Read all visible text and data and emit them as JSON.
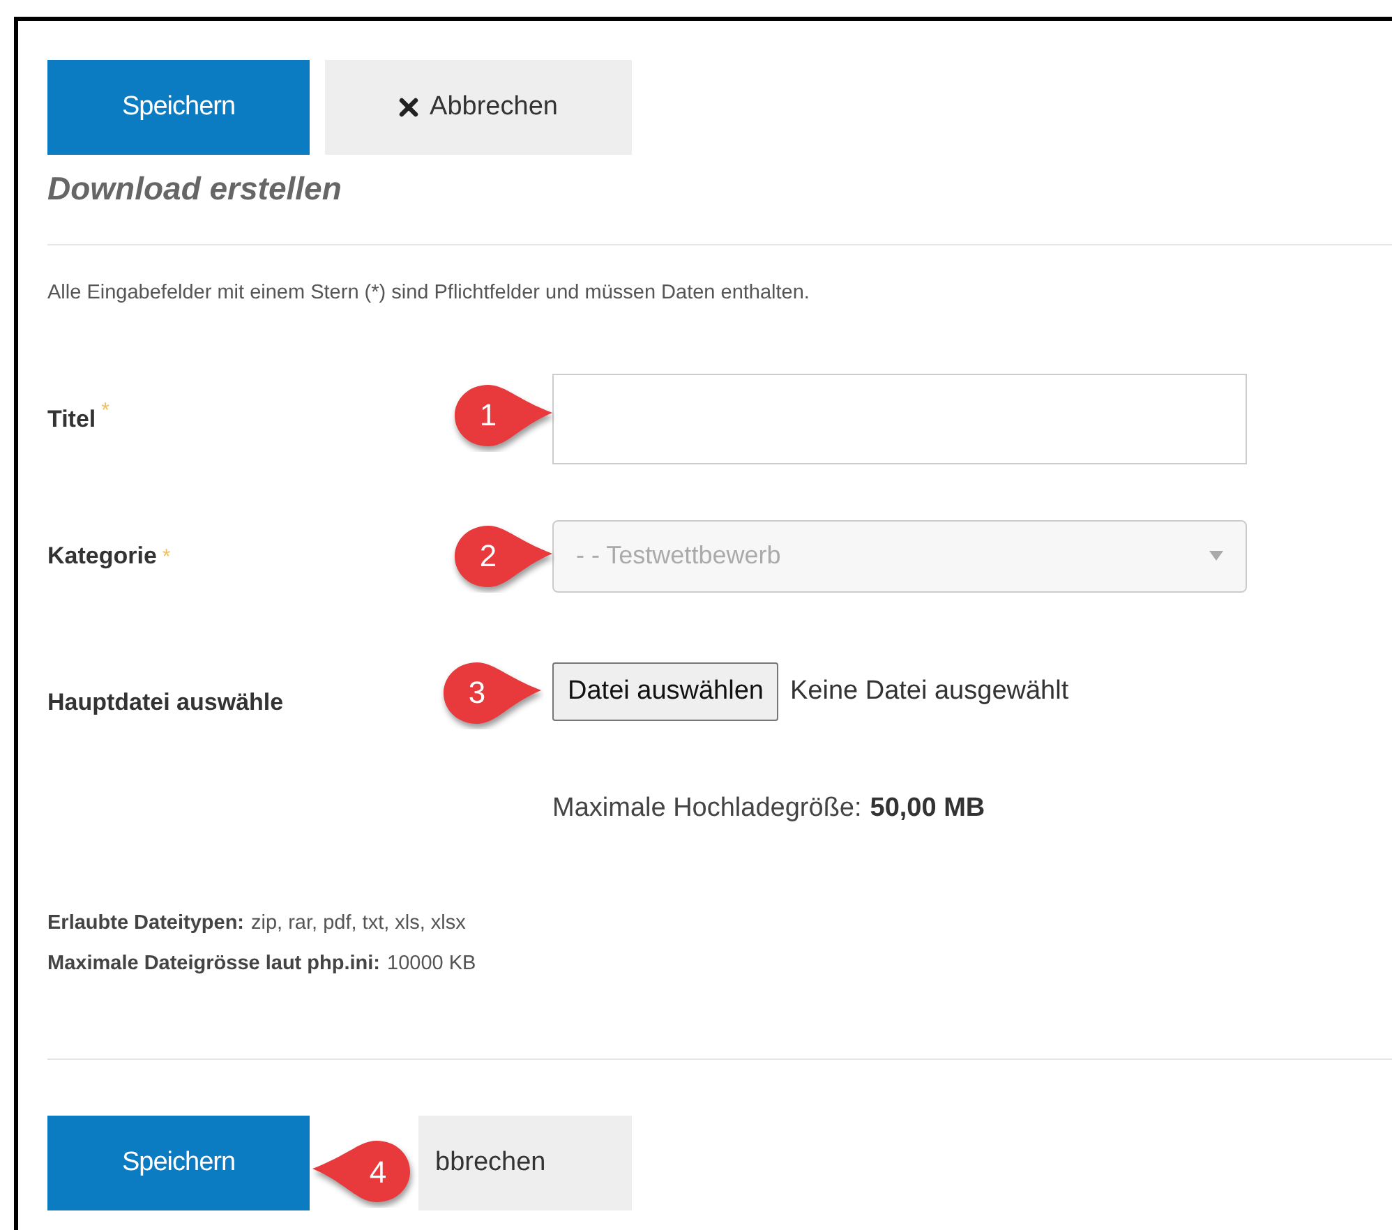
{
  "top_buttons": [
    {
      "kind": "primary",
      "label": "Speichern"
    },
    {
      "kind": "cancel",
      "label": "Abbrechen"
    }
  ],
  "heading": "Download erstellen",
  "note": "Alle Eingabefelder mit einem Stern (*) sind Pflichtfelder und müssen Daten enthalten.",
  "fields": [
    {
      "kind": "text",
      "label": "Titel",
      "required_mark": "*",
      "marker": "1"
    },
    {
      "kind": "select",
      "label": "Kategorie",
      "required_mark": "*",
      "value": "- - Testwettbewerb",
      "disabled": true,
      "marker": "2"
    },
    {
      "kind": "file",
      "label": "Hauptdatei auswähle",
      "button": "Datei auswählen",
      "status": "Keine Datei ausgewählt",
      "marker": "3",
      "hint_label": "Maximale Hochladegröße:",
      "hint_value": "50,00 MB"
    }
  ],
  "info": [
    {
      "label": "Erlaubte Dateitypen:",
      "value": "zip, rar, pdf, txt, xls, xlsx"
    },
    {
      "label": "Maximale Dateigrösse laut php.ini:",
      "value": "10000 KB"
    }
  ],
  "bottom_buttons": [
    {
      "kind": "primary",
      "label": "Speichern"
    },
    {
      "kind": "covered",
      "label": "bbrechen"
    }
  ],
  "bottom_marker": "4"
}
